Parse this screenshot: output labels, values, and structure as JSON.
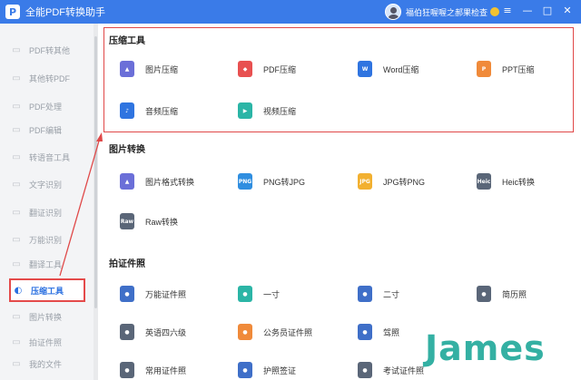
{
  "app": {
    "logo_letter": "P",
    "title": "全能PDF转换助手"
  },
  "user": {
    "name": "福伯狂喔喔之郝果检查"
  },
  "window": {
    "menu": "≡",
    "minimize": "—",
    "maximize": "□",
    "close": "✕"
  },
  "sidebar": {
    "items": [
      {
        "label": "PDF转其他",
        "icon": "▭"
      },
      {
        "label": "其他转PDF",
        "icon": "▭"
      },
      {
        "label": "PDF处理",
        "icon": "▭"
      },
      {
        "label": "PDF编辑",
        "icon": "▭"
      },
      {
        "label": "转语音工具",
        "icon": "▭"
      },
      {
        "label": "文字识别",
        "icon": "▭"
      },
      {
        "label": "翻证识别",
        "icon": "▭"
      },
      {
        "label": "万能识别",
        "icon": "▭"
      },
      {
        "label": "翻译工具",
        "icon": "▭"
      },
      {
        "label": "压缩工具",
        "icon": "◐"
      },
      {
        "label": "图片转换",
        "icon": "▭"
      },
      {
        "label": "拍证件照",
        "icon": "▭"
      },
      {
        "label": "我的文件",
        "icon": "▭"
      }
    ]
  },
  "sections": {
    "compress": {
      "title": "压缩工具",
      "tools": [
        {
          "label": "图片压缩",
          "icon": "image-icon",
          "color": "#6b6fd8"
        },
        {
          "label": "PDF压缩",
          "icon": "pdf-icon",
          "color": "#e85050"
        },
        {
          "label": "Word压缩",
          "icon": "word-icon",
          "color": "#2f74e0"
        },
        {
          "label": "PPT压缩",
          "icon": "ppt-icon",
          "color": "#f08a3a"
        },
        {
          "label": "音频压缩",
          "icon": "audio-icon",
          "color": "#2f74e0"
        },
        {
          "label": "视频压缩",
          "icon": "video-icon",
          "color": "#2bb5a6"
        }
      ]
    },
    "image": {
      "title": "图片转换",
      "tools": [
        {
          "label": "图片格式转换",
          "icon": "image-icon",
          "color": "#6b6fd8",
          "badge": ""
        },
        {
          "label": "PNG转JPG",
          "icon": "png-icon",
          "color": "#2f8ee0",
          "badge": "PNG"
        },
        {
          "label": "JPG转PNG",
          "icon": "jpg-icon",
          "color": "#f2b030",
          "badge": "JPG"
        },
        {
          "label": "Heic转换",
          "icon": "heic-icon",
          "color": "#5a6678",
          "badge": "Heic"
        },
        {
          "label": "Raw转换",
          "icon": "raw-icon",
          "color": "#5a6678",
          "badge": "Raw"
        }
      ]
    },
    "photo": {
      "title": "拍证件照",
      "tools": [
        {
          "label": "万能证件照",
          "icon": "id-photo-icon",
          "color": "#3f6fc8"
        },
        {
          "label": "一寸",
          "icon": "one-inch-icon",
          "color": "#2bb5a6"
        },
        {
          "label": "二寸",
          "icon": "two-inch-icon",
          "color": "#3f6fc8"
        },
        {
          "label": "简历照",
          "icon": "resume-icon",
          "color": "#5a6678"
        },
        {
          "label": "英语四六级",
          "icon": "cet-icon",
          "color": "#5a6678"
        },
        {
          "label": "公务员证件照",
          "icon": "civil-icon",
          "color": "#f08a3a"
        },
        {
          "label": "驾照",
          "icon": "license-icon",
          "color": "#3f6fc8"
        },
        {
          "label": "常用证件照",
          "icon": "common-id-icon",
          "color": "#5a6678"
        },
        {
          "label": "护照签证",
          "icon": "passport-icon",
          "color": "#3f6fc8"
        },
        {
          "label": "考试证件照",
          "icon": "exam-icon",
          "color": "#5a6678"
        }
      ]
    }
  },
  "watermark": {
    "text": "James"
  },
  "colors": {
    "titlebar": "#3a7be8",
    "accent": "#2a6fe0",
    "highlight": "#e04848"
  }
}
